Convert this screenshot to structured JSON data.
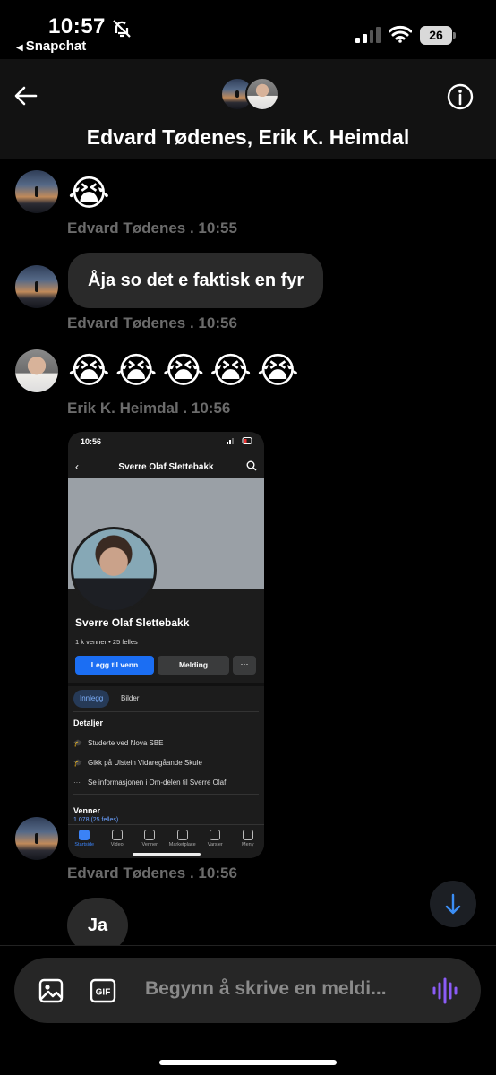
{
  "status_bar": {
    "time": "10:57",
    "back_app": "Snapchat",
    "battery": "26"
  },
  "header": {
    "title": "Edvard Tødenes, Erik K. Heimdal"
  },
  "messages": [
    {
      "sender": "Edvard Tødenes",
      "meta": "Edvard Tødenes . 10:55",
      "content": "😭"
    },
    {
      "sender": "Edvard Tødenes",
      "meta": "Edvard Tødenes . 10:56",
      "content": "Åja so det e faktisk en fyr"
    },
    {
      "sender": "Erik K. Heimdal",
      "meta": "Erik K. Heimdal . 10:56",
      "content": "😭😭😭😭😭"
    },
    {
      "sender": "Edvard Tødenes",
      "meta": "Edvard Tødenes . 10:56",
      "content": "Ja"
    }
  ],
  "shared_screenshot": {
    "time": "10:56",
    "title": "Sverre Olaf Slettebakk",
    "name": "Sverre Olaf Slettebakk",
    "stats": "1 k venner • 25 felles",
    "add_friend": "Legg til venn",
    "message": "Melding",
    "more": "···",
    "tab_posts": "Innlegg",
    "tab_photos": "Bilder",
    "details_heading": "Detaljer",
    "detail_1": "Studerte ved Nova SBE",
    "detail_2": "Gikk på Ulstein Vidaregåande Skule",
    "detail_3": "Se informasjonen i Om-delen til Sverre Olaf",
    "friends_heading": "Venner",
    "friends_count": "1 078 (25 felles)",
    "nav": [
      "Startside",
      "Video",
      "Venner",
      "Marketplace",
      "Varsler",
      "Meny"
    ]
  },
  "composer": {
    "placeholder": "Begynn å skrive en meldi..."
  },
  "colors": {
    "background": "#000000",
    "bubble": "#2a2a2a",
    "meta_text": "#6b6b6b",
    "accent_voice": "#8b5cf6",
    "fb_blue": "#1b6ef3"
  }
}
